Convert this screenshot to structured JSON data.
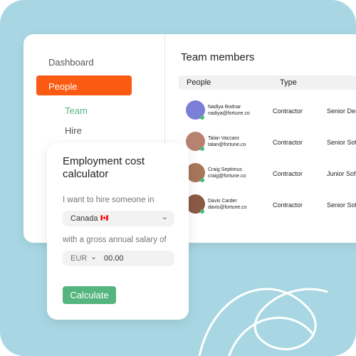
{
  "sidebar": {
    "items": [
      "Dashboard",
      "People",
      "Team",
      "Hire"
    ]
  },
  "main": {
    "title": "Team members",
    "columns": [
      "People",
      "Type"
    ],
    "rows": [
      {
        "name": "Nadiya Bodnar",
        "email": "nadiya@fortune.co",
        "type": "Contractor",
        "role": "Senior Des"
      },
      {
        "name": "Talan Vaccaro",
        "email": "talan@fortune.co",
        "type": "Contractor",
        "role": "Senior Sof"
      },
      {
        "name": "Craig Septimus",
        "email": "craig@fortune.co",
        "type": "Contractor",
        "role": "Junior Sof"
      },
      {
        "name": "Davis Carder",
        "email": "davis@fortune.co",
        "type": "Contractor",
        "role": "Senior Sof"
      }
    ]
  },
  "calculator": {
    "title": "Employment cost calculator",
    "country_label": "I want to hire someone in",
    "country": "Canada",
    "flag": "🇨🇦",
    "salary_label": "with a gross annual salary of",
    "currency": "EUR",
    "amount": "00.00",
    "button": "Calculate"
  },
  "colors": {
    "accent": "#fb5a12",
    "green": "#55b57e",
    "background": "#a8d7e3"
  }
}
